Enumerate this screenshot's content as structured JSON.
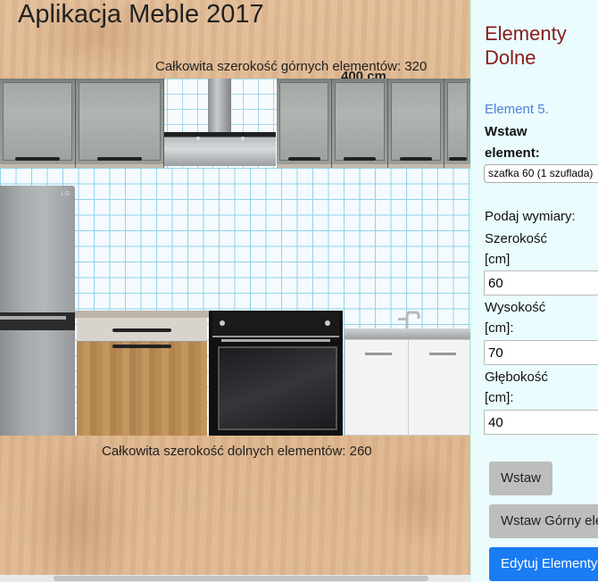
{
  "app": {
    "title": "Aplikacja Meble 2017"
  },
  "upper": {
    "total_text": "Całkowita szerokość górnych elementów: 320",
    "dim_text": "400 cm"
  },
  "lower": {
    "total_text": "Całkowita szerokość dolnych elementów: 260"
  },
  "fridge": {
    "logo": "LG"
  },
  "panel": {
    "title": "Elementy Dolne",
    "element_number": "Element 5.",
    "insert_label": "Wstaw element:",
    "select_value": "szafka 60 (1 szuflada)",
    "dims_prompt": "Podaj wymiary:",
    "width_label": "Szerokość [cm]",
    "width_value": "60",
    "height_label": "Wysokość [cm]:",
    "height_value": "70",
    "depth_label": "Głębokość [cm]:",
    "depth_value": "40",
    "insert_button": "Wstaw",
    "insert_upper_button": "Wstaw Górny element",
    "edit_button": "Edytuj Elementy"
  },
  "colors": {
    "title_red": "#8b1a1a",
    "element_blue": "#4d7fd8",
    "button_blue": "#1a7cf3",
    "panel_bg": "#eafcfd"
  }
}
